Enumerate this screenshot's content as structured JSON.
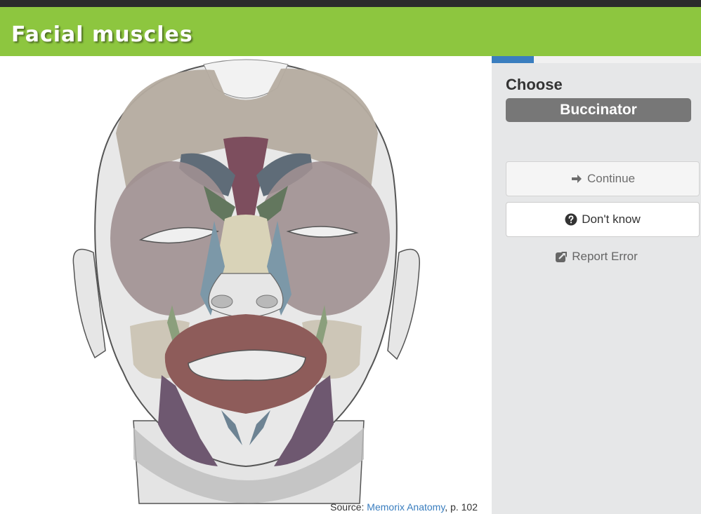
{
  "header": {
    "title": "Facial muscles"
  },
  "progress": {
    "fraction": 0.2
  },
  "quiz": {
    "prompt": "Choose",
    "answer": "Buccinator",
    "continue_label": "Continue",
    "dont_know_label": "Don't know",
    "report_label": "Report Error"
  },
  "source": {
    "prefix": "Source: ",
    "link_text": "Memorix Anatomy",
    "suffix": ", p. 102"
  },
  "colors": {
    "header_green": "#8dc63f",
    "accent_blue": "#3a7ebf",
    "badge_gray": "#777777",
    "sidebar_bg": "#e6e7e8"
  },
  "icons": {
    "continue": "arrow-right-icon",
    "dont_know": "question-circle-icon",
    "report": "external-link-icon"
  }
}
